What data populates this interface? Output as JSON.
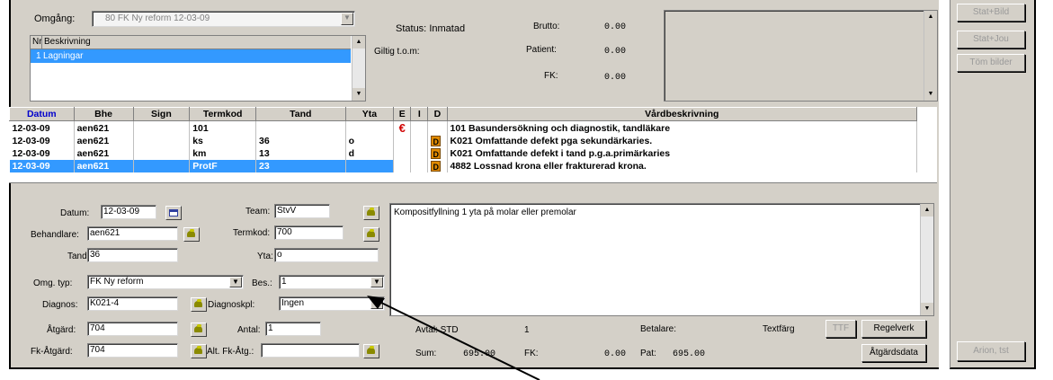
{
  "colors": {
    "panel": "#d4d0c8",
    "selection": "#3399ff",
    "datum_header": "#0000cc",
    "d_badge": "#e08a00",
    "euro": "#d00000"
  },
  "top": {
    "omgang_label": "Omgång:",
    "omgang_value": "80 FK Ny reform  12-03-09",
    "list_headers": {
      "nr": "Nr",
      "beskrivning": "Beskrivning"
    },
    "list_items": [
      {
        "nr": "1",
        "text": "Lagningar"
      }
    ],
    "status_label": "Status:",
    "status_value": "Inmatad",
    "giltig_label": "Giltig t.o.m:",
    "brutto_label": "Brutto:",
    "brutto_value": "0.00",
    "patient_label": "Patient:",
    "patient_value": "0.00",
    "fk_label": "FK:",
    "fk_value": "0.00"
  },
  "right_buttons": {
    "stat_bild": "Stat+Bild",
    "stat_jou": "Stat+Jou",
    "tom_bilder": "Töm bilder",
    "arion": "Arion, tst"
  },
  "table": {
    "headers": [
      "Datum",
      "Bhe",
      "Sign",
      "Termkod",
      "Tand",
      "Yta",
      "E",
      "I",
      "D",
      "Vårdbeskrivning"
    ],
    "rows": [
      {
        "datum": "12-03-09",
        "bhe": "aen621",
        "sign": "",
        "termkod": "101",
        "tand": "",
        "yta": "",
        "e": "€",
        "i": "",
        "d": "",
        "desc": "101 Basundersökning och diagnostik, tandläkare"
      },
      {
        "datum": "12-03-09",
        "bhe": "aen621",
        "sign": "",
        "termkod": "ks",
        "tand": "36",
        "yta": "o",
        "e": "",
        "i": "",
        "d": "D",
        "desc": "K021 Omfattande defekt pga sekundärkaries."
      },
      {
        "datum": "12-03-09",
        "bhe": "aen621",
        "sign": "",
        "termkod": "km",
        "tand": "13",
        "yta": "d",
        "e": "",
        "i": "",
        "d": "D",
        "desc": "K021 Omfattande defekt i tand p.g.a.primärkaries"
      },
      {
        "datum": "12-03-09",
        "bhe": "aen621",
        "sign": "",
        "termkod": "ProtF",
        "tand": "23",
        "yta": "",
        "e": "",
        "i": "",
        "d": "D",
        "desc": "4882 Lossnad krona eller frakturerad krona."
      }
    ],
    "selected_row": 3
  },
  "form": {
    "datum_label": "Datum:",
    "datum_value": "12-03-09",
    "team_label": "Team:",
    "team_value": "StvV",
    "behandlare_label": "Behandlare:",
    "behandlare_value": "aen621",
    "termkod_label": "Termkod:",
    "termkod_value": "700",
    "tand_label": "Tand:",
    "tand_value": "36",
    "yta_label": "Yta:",
    "yta_value": "o",
    "omg_typ_label": "Omg. typ:",
    "omg_typ_value": "FK Ny reform",
    "bes_label": "Bes.:",
    "bes_value": "1",
    "diagnos_label": "Diagnos:",
    "diagnos_value": "K021-4",
    "diagnoskpl_label": "Diagnoskpl:",
    "diagnoskpl_value": "Ingen",
    "atgard_label": "Åtgärd:",
    "atgard_value": "704",
    "antal_label": "Antal:",
    "antal_value": "1",
    "fk_atgard_label": "Fk-Åtgärd:",
    "fk_atgard_value": "704",
    "alt_fk_label": "Alt. Fk-Åtg.:",
    "alt_fk_value": "",
    "description_text": "Kompositfyllning 1 yta på molar eller premolar"
  },
  "bottom": {
    "avtal_label": "Avtal:",
    "avtal_value": "STD",
    "avtal_num": "1",
    "betalare_label": "Betalare:",
    "textfarg_label": "Textfärg",
    "ttf_label": "TTF",
    "regelverk_label": "Regelverk",
    "sum_label": "Sum:",
    "sum_value": "695.00",
    "fk_label": "FK:",
    "fk_value": "0.00",
    "pat_label": "Pat:",
    "pat_value": "695.00",
    "atgardsdata_label": "Åtgärdsdata"
  }
}
